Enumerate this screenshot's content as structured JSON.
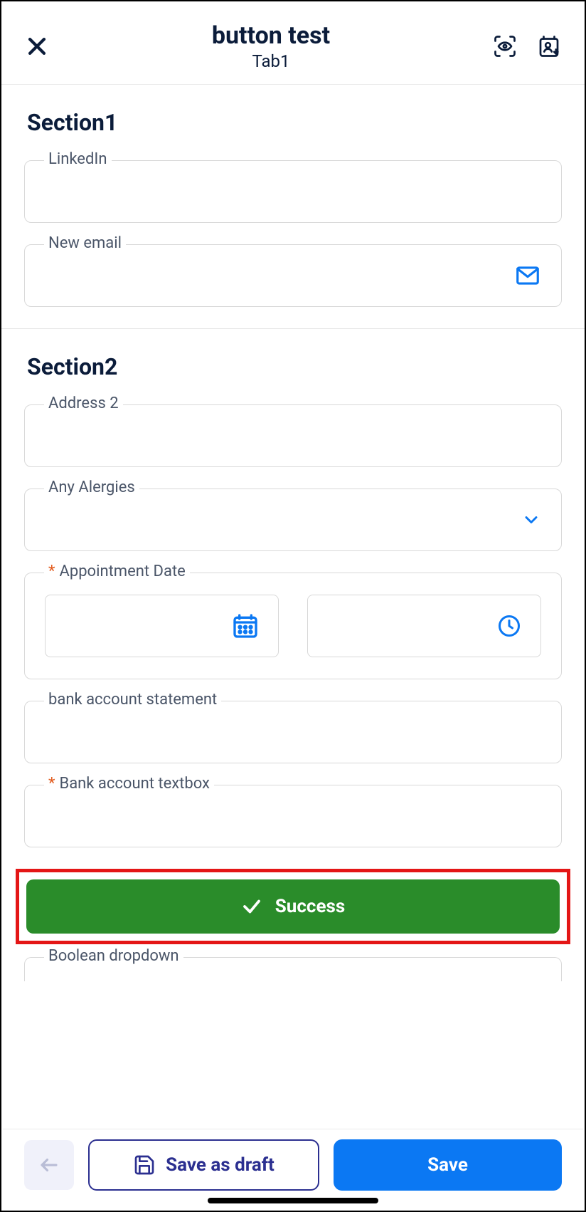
{
  "header": {
    "title": "button test",
    "subtitle": "Tab1"
  },
  "sections": {
    "s1": {
      "title": "Section1",
      "linkedin_label": "LinkedIn",
      "newemail_label": "New email"
    },
    "s2": {
      "title": "Section2",
      "address2_label": "Address 2",
      "allergies_label": "Any Alergies",
      "appointment_label": "Appointment Date",
      "bank_stmt_label": "bank account statement",
      "bank_textbox_label": "Bank account textbox",
      "boolean_label": "Boolean dropdown"
    }
  },
  "success_label": "Success",
  "footer": {
    "draft_label": "Save as draft",
    "save_label": "Save"
  }
}
